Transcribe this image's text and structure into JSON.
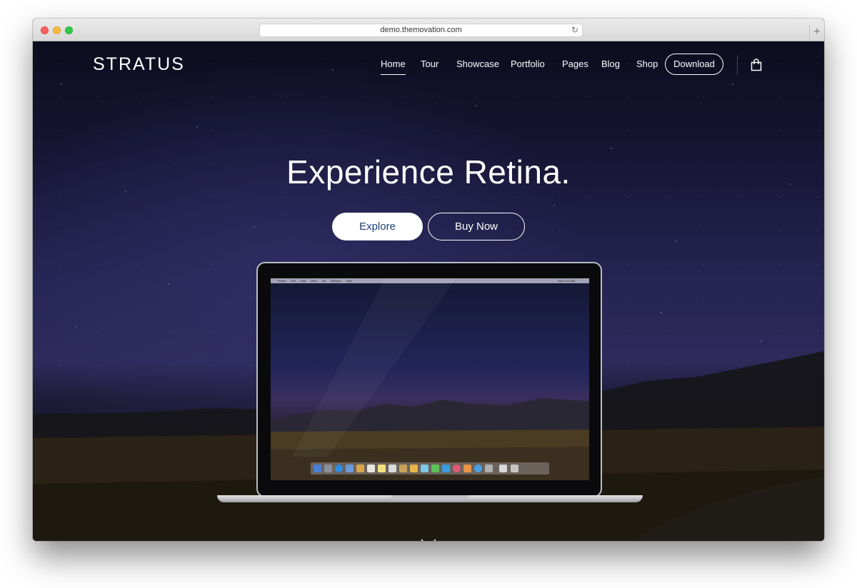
{
  "browser": {
    "url": "demo.themovation.com",
    "reload_icon": "reload-icon",
    "new_tab_icon": "plus-icon",
    "new_tab_label": "+"
  },
  "site": {
    "logo": "STRATUS",
    "nav": [
      "Home",
      "Tour",
      "Showcase",
      "Portfolio",
      "Pages",
      "Blog",
      "Shop"
    ],
    "active_nav": "Home",
    "download_label": "Download",
    "cart_icon": "shopping-bag-icon"
  },
  "hero": {
    "title": "Experience Retina.",
    "explore_label": "Explore",
    "buy_label": "Buy Now",
    "scroll_icon": "chevron-down-icon"
  },
  "laptop_screen": {
    "menubar": [
      "Finder",
      "File",
      "Edit",
      "View",
      "Go",
      "Window",
      "Help"
    ],
    "clock": "Mon 9:41 AM"
  },
  "colors": {
    "explore_text": "#1e3e78",
    "sky_top": "#0c0d1e",
    "sky_mid": "#2e2a5b",
    "ground": "#14120f"
  }
}
